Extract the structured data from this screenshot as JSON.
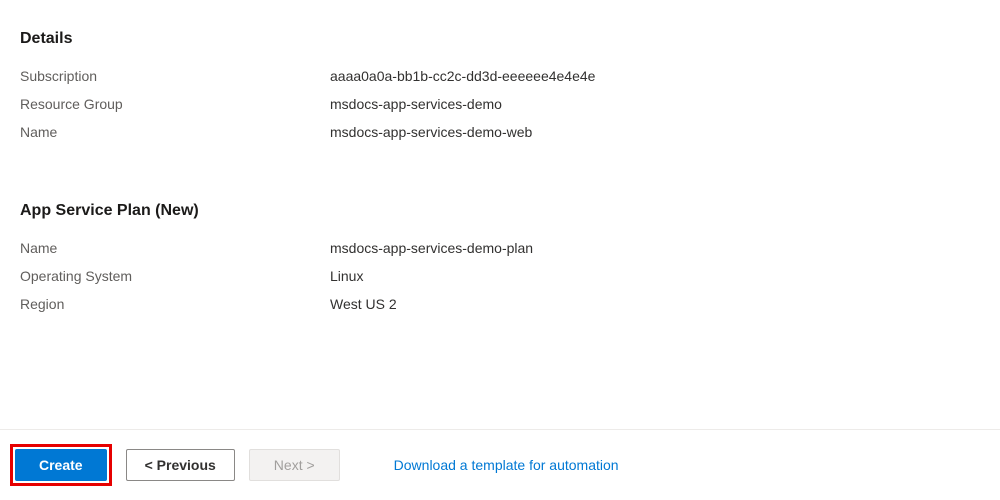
{
  "details": {
    "title": "Details",
    "fields": [
      {
        "label": "Subscription",
        "value": "aaaa0a0a-bb1b-cc2c-dd3d-eeeeee4e4e4e"
      },
      {
        "label": "Resource Group",
        "value": "msdocs-app-services-demo"
      },
      {
        "label": "Name",
        "value": "msdocs-app-services-demo-web"
      }
    ]
  },
  "app_service_plan": {
    "title": "App Service Plan (New)",
    "fields": [
      {
        "label": "Name",
        "value": "msdocs-app-services-demo-plan"
      },
      {
        "label": "Operating System",
        "value": "Linux"
      },
      {
        "label": "Region",
        "value": "West US 2"
      }
    ]
  },
  "footer": {
    "create": "Create",
    "previous": "< Previous",
    "next": "Next >",
    "download_link": "Download a template for automation"
  }
}
